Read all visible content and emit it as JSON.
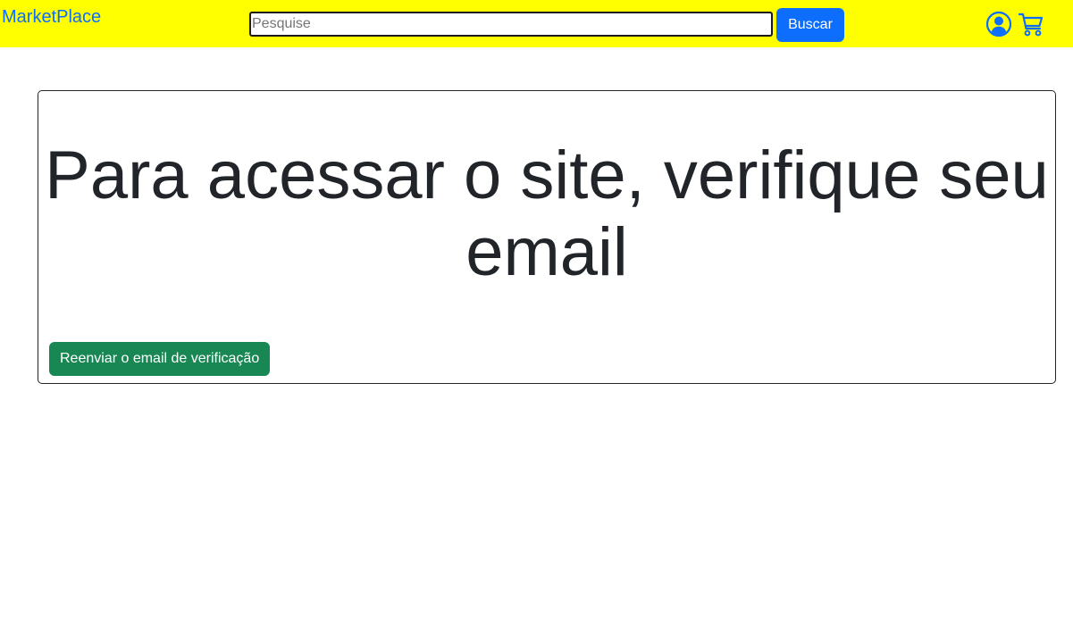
{
  "navbar": {
    "brand": "MarketPlace",
    "search": {
      "placeholder": "Pesquise",
      "value": "",
      "button_label": "Buscar"
    },
    "icons": [
      "user-icon",
      "cart-icon"
    ]
  },
  "card": {
    "title": "Para acessar o site, verifique seu email",
    "resend_button_label": "Reenviar o email de verificação"
  },
  "colors": {
    "navbar_background": "#ffff00",
    "primary": "#0d6efd",
    "success": "#198754",
    "text": "#212529"
  }
}
